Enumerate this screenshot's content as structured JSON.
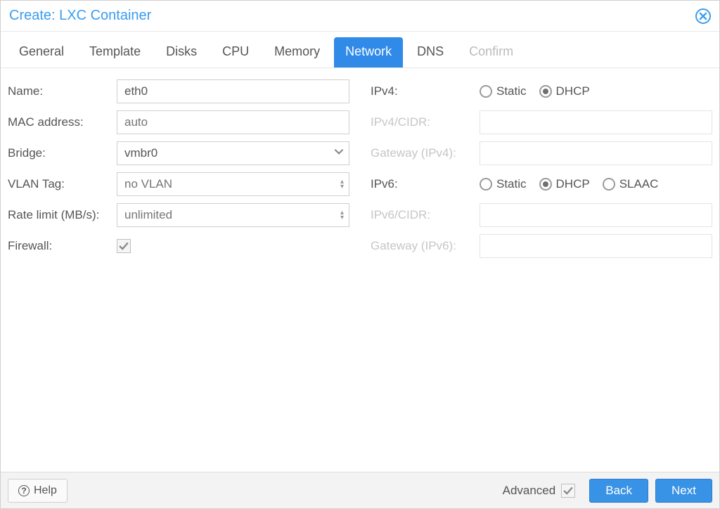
{
  "title": "Create: LXC Container",
  "tabs": [
    {
      "label": "General"
    },
    {
      "label": "Template"
    },
    {
      "label": "Disks"
    },
    {
      "label": "CPU"
    },
    {
      "label": "Memory"
    },
    {
      "label": "Network",
      "active": true
    },
    {
      "label": "DNS"
    },
    {
      "label": "Confirm",
      "disabled": true
    }
  ],
  "left": {
    "name_label": "Name:",
    "name_value": "eth0",
    "mac_label": "MAC address:",
    "mac_placeholder": "auto",
    "bridge_label": "Bridge:",
    "bridge_value": "vmbr0",
    "vlan_label": "VLAN Tag:",
    "vlan_placeholder": "no VLAN",
    "rate_label": "Rate limit (MB/s):",
    "rate_placeholder": "unlimited",
    "firewall_label": "Firewall:",
    "firewall_checked": true
  },
  "right": {
    "ipv4_label": "IPv4:",
    "ipv4_opts": {
      "static": "Static",
      "dhcp": "DHCP"
    },
    "ipv4_selected": "dhcp",
    "ipv4_cidr_label": "IPv4/CIDR:",
    "ipv4_gw_label": "Gateway (IPv4):",
    "ipv6_label": "IPv6:",
    "ipv6_opts": {
      "static": "Static",
      "dhcp": "DHCP",
      "slaac": "SLAAC"
    },
    "ipv6_selected": "dhcp",
    "ipv6_cidr_label": "IPv6/CIDR:",
    "ipv6_gw_label": "Gateway (IPv6):"
  },
  "footer": {
    "help": "Help",
    "advanced": "Advanced",
    "advanced_checked": true,
    "back": "Back",
    "next": "Next"
  }
}
